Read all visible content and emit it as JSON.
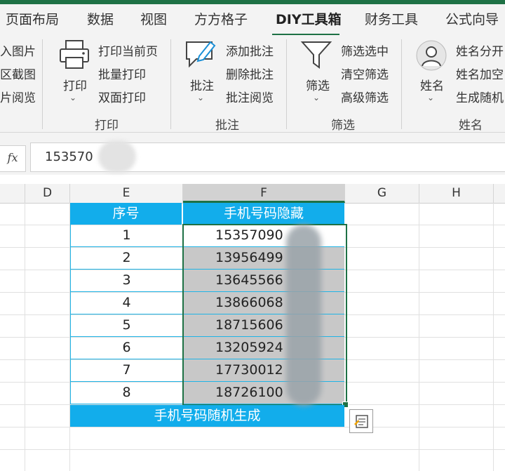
{
  "tabs": [
    "页面布局",
    "数据",
    "视图",
    "方方格子",
    "DIY工具箱",
    "财务工具",
    "公式向导"
  ],
  "active_tab": "DIY工具箱",
  "ribbon": {
    "picture_group": {
      "items": [
        "入图片",
        "区截图",
        "片阅览"
      ]
    },
    "print_group": {
      "big_label": "打印",
      "items": [
        "打印当前页",
        "批量打印",
        "双面打印"
      ],
      "group_label": "打印"
    },
    "comment_group": {
      "big_label": "批注",
      "items": [
        "添加批注",
        "删除批注",
        "批注阅览"
      ],
      "group_label": "批注"
    },
    "filter_group": {
      "big_label": "筛选",
      "items": [
        "筛选选中",
        "清空筛选",
        "高级筛选"
      ],
      "group_label": "筛选"
    },
    "name_group": {
      "big_label": "姓名",
      "items": [
        "姓名分开",
        "姓名加空",
        "生成随机"
      ],
      "group_label": "姓名"
    }
  },
  "formula_bar": {
    "fx_label": "fx",
    "value": "153570"
  },
  "columns": [
    "D",
    "E",
    "F",
    "G",
    "H"
  ],
  "table": {
    "header_index": "序号",
    "header_phone": "手机号码隐藏",
    "rows": [
      {
        "index": "1",
        "phone": "15357090"
      },
      {
        "index": "2",
        "phone": "13956499"
      },
      {
        "index": "3",
        "phone": "13645566"
      },
      {
        "index": "4",
        "phone": "13866068"
      },
      {
        "index": "5",
        "phone": "18715606"
      },
      {
        "index": "6",
        "phone": "13205924"
      },
      {
        "index": "7",
        "phone": "17730012"
      },
      {
        "index": "8",
        "phone": "18726100"
      }
    ],
    "footer": "手机号码随机生成"
  },
  "colors": {
    "accent": "#1e7145",
    "table_header": "#12adeb",
    "selection": "#c8c8c8"
  }
}
